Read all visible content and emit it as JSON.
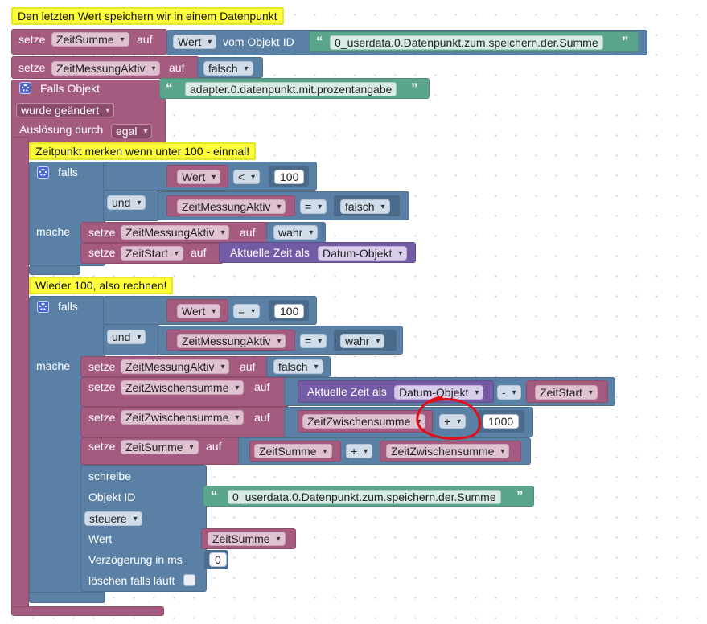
{
  "c1": {
    "text": "Den letzten Wert speichern wir in einem Datenpunkt"
  },
  "b1": {
    "setze": "setze",
    "var": "ZeitSumme",
    "auf": "auf",
    "attr": "Wert",
    "vom": "vom Objekt ID",
    "id": "0_userdata.0.Datenpunkt.zum.speichern.der.Summe"
  },
  "b2": {
    "setze": "setze",
    "var": "ZeitMessungAktiv",
    "auf": "auf",
    "val": "falsch"
  },
  "trig": {
    "falls": "Falls Objekt",
    "id": "adapter.0.datenpunkt.mit.prozentangabe",
    "mode": "wurde geändert",
    "ausl": "Auslösung durch",
    "ausl_val": "egal"
  },
  "c2": {
    "text": "Zeitpunkt merken wenn unter 100 - einmal!"
  },
  "if1": {
    "falls": "falls",
    "wert": "Wert",
    "op": "<",
    "num": "100",
    "und": "und",
    "var": "ZeitMessungAktiv",
    "eq": "=",
    "val": "falsch",
    "mache": "mache",
    "s1": {
      "setze": "setze",
      "var": "ZeitMessungAktiv",
      "auf": "auf",
      "val": "wahr"
    },
    "s2": {
      "setze": "setze",
      "var": "ZeitStart",
      "auf": "auf",
      "time": "Aktuelle Zeit als",
      "fmt": "Datum-Objekt"
    }
  },
  "c3": {
    "text": "Wieder 100, also rechnen!"
  },
  "if2": {
    "falls": "falls",
    "wert": "Wert",
    "op": "=",
    "num": "100",
    "und": "und",
    "var": "ZeitMessungAktiv",
    "eq": "=",
    "val": "wahr",
    "mache": "mache",
    "s1": {
      "setze": "setze",
      "var": "ZeitMessungAktiv",
      "auf": "auf",
      "val": "falsch"
    },
    "s2": {
      "setze": "setze",
      "var": "ZeitZwischensumme",
      "auf": "auf",
      "time": "Aktuelle Zeit als",
      "fmt": "Datum-Objekt",
      "op": "-",
      "rhs": "ZeitStart"
    },
    "s3": {
      "setze": "setze",
      "var": "ZeitZwischensumme",
      "auf": "auf",
      "lhs": "ZeitZwischensumme",
      "op": "+",
      "num": "1000"
    },
    "s4": {
      "setze": "setze",
      "var": "ZeitSumme",
      "auf": "auf",
      "lhs": "ZeitSumme",
      "op": "+",
      "rhs": "ZeitZwischensumme"
    },
    "w": {
      "schreibe": "schreibe",
      "obj": "Objekt ID",
      "id": "0_userdata.0.Datenpunkt.zum.speichern.der.Summe",
      "mode": "steuere",
      "wert": "Wert",
      "val": "ZeitSumme",
      "delay": "Verzögerung in ms",
      "delay_val": "0",
      "clear": "löschen falls läuft"
    }
  },
  "colors": {
    "variables": "#a55b80",
    "logic": "#5b80a5",
    "time": "#745ba5",
    "text": "#5ba58c",
    "comment": "#fdfd3a",
    "annotation": "#e0101a"
  }
}
